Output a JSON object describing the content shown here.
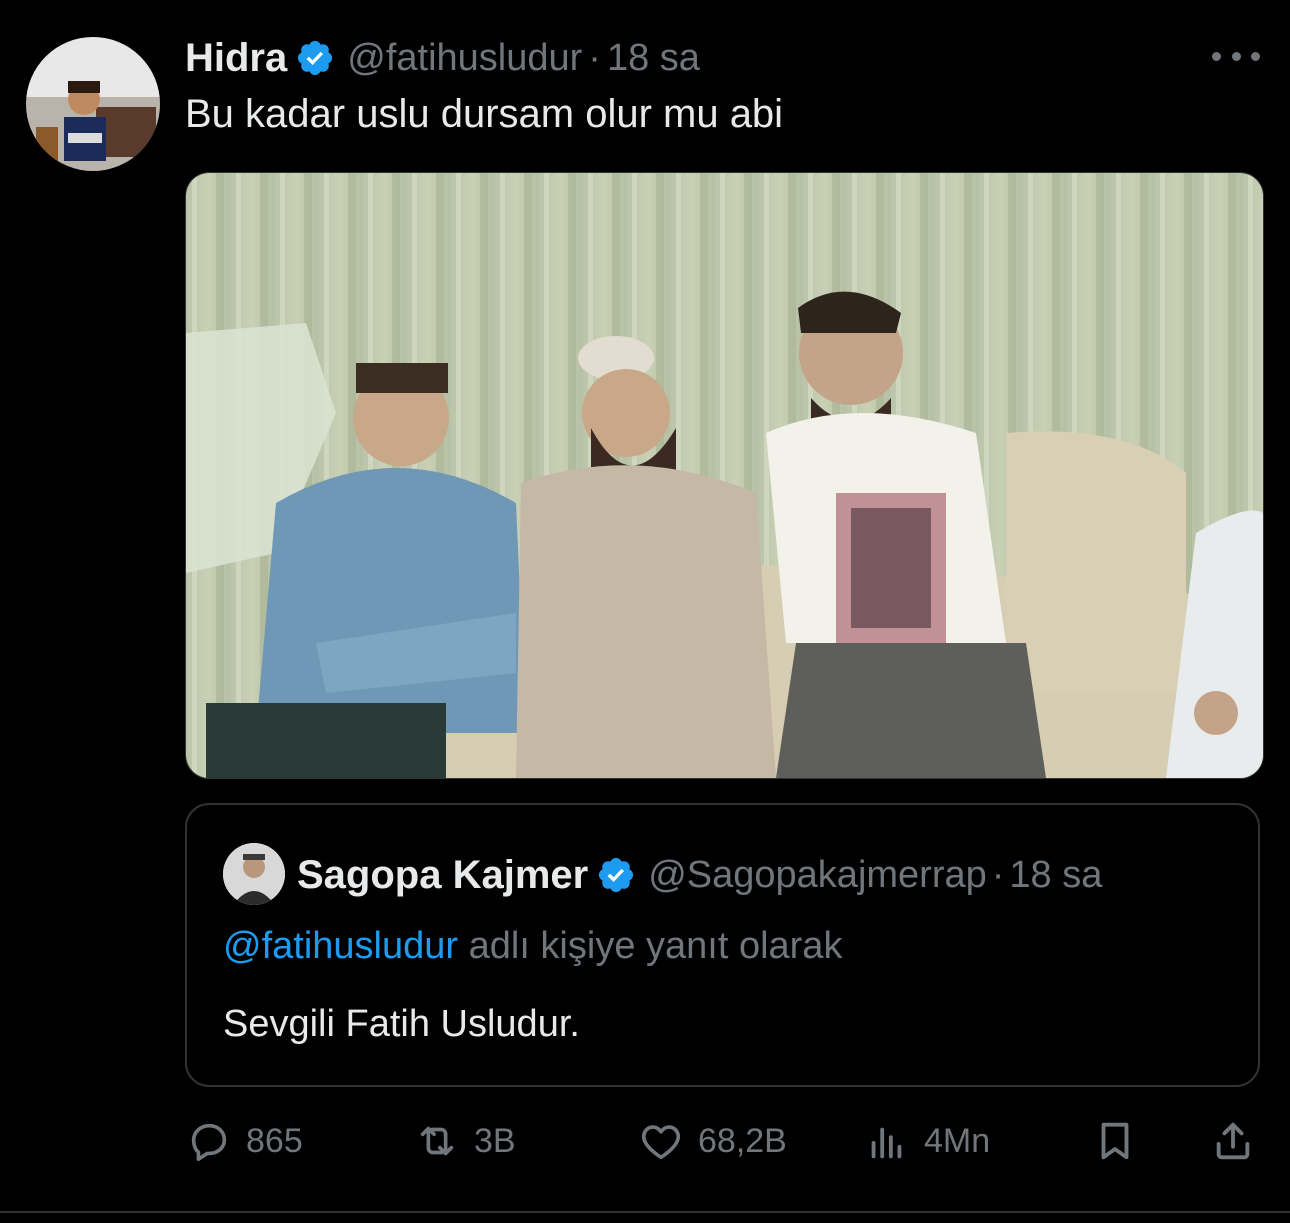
{
  "tweet": {
    "display_name": "Hidra",
    "handle": "@fatihusludur",
    "separator": "·",
    "time": "18 sa",
    "text": "Bu kadar uslu dursam olur mu abi"
  },
  "quote": {
    "display_name": "Sagopa Kajmer",
    "handle": "@Sagopakajmerrap",
    "separator": "·",
    "time": "18 sa",
    "reply_mention": "@fatihusludur",
    "reply_suffix": " adlı kişiye yanıt olarak",
    "text": "Sevgili Fatih Usludur."
  },
  "actions": {
    "replies": "865",
    "reposts": "3B",
    "likes": "68,2B",
    "views": "4Mn"
  },
  "colors": {
    "background": "#000000",
    "text_primary": "#e7e9ea",
    "text_secondary": "#71767b",
    "accent_blue": "#1d9bf0",
    "border": "#2f3336"
  },
  "icons": {
    "verified": "verified-badge-icon",
    "more": "more-options-icon",
    "reply": "reply-icon",
    "repost": "repost-icon",
    "like": "like-icon",
    "views": "views-icon",
    "bookmark": "bookmark-icon",
    "share": "share-icon"
  }
}
